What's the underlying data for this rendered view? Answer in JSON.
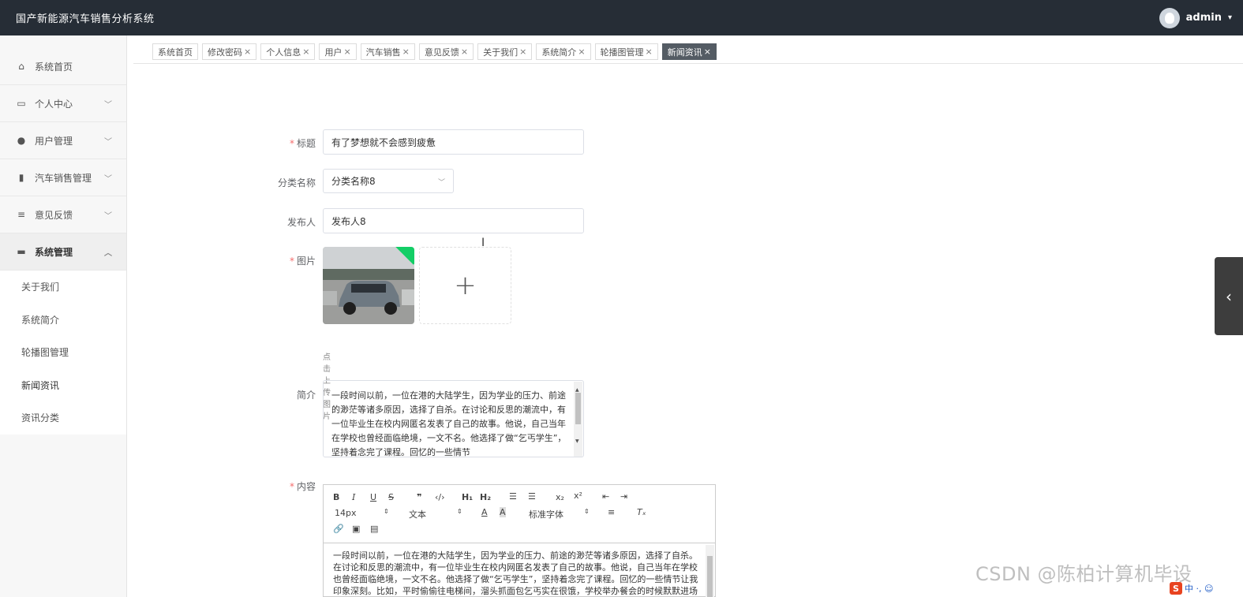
{
  "header": {
    "app_title": "国产新能源汽车销售分析系统",
    "username": "admin",
    "caret": "▾"
  },
  "sidebar": {
    "items": [
      {
        "label": "系统首页",
        "icon": "home-icon"
      },
      {
        "label": "个人中心",
        "icon": "id-card-icon"
      },
      {
        "label": "用户管理",
        "icon": "user-icon"
      },
      {
        "label": "汽车销售管理",
        "icon": "bookmark-icon"
      },
      {
        "label": "意见反馈",
        "icon": "list-icon"
      },
      {
        "label": "系统管理",
        "icon": "chat-icon"
      }
    ],
    "sub_items": [
      "关于我们",
      "系统简介",
      "轮播图管理",
      "新闻资讯",
      "资讯分类"
    ],
    "active_sub": "新闻资讯"
  },
  "tabs": [
    {
      "label": "系统首页",
      "closable": false
    },
    {
      "label": "修改密码",
      "closable": true
    },
    {
      "label": "个人信息",
      "closable": true
    },
    {
      "label": "用户",
      "closable": true
    },
    {
      "label": "汽车销售",
      "closable": true
    },
    {
      "label": "意见反馈",
      "closable": true
    },
    {
      "label": "关于我们",
      "closable": true
    },
    {
      "label": "系统简介",
      "closable": true
    },
    {
      "label": "轮播图管理",
      "closable": true
    },
    {
      "label": "新闻资讯",
      "closable": true,
      "active": true
    }
  ],
  "form": {
    "title_label": "标题",
    "title_value": "有了梦想就不会感到疲惫",
    "category_label": "分类名称",
    "category_value": "分类名称8",
    "publisher_label": "发布人",
    "publisher_value": "发布人8",
    "image_label": "图片",
    "upload_plus": "+",
    "upload_hint": "点击上传图片",
    "intro_label": "简介",
    "intro_text": "一段时间以前，一位在港的大陆学生，因为学业的压力、前途的渺茫等诸多原因，选择了自杀。在讨论和反思的潮流中，有一位毕业生在校内网匿名发表了自己的故事。他说，自己当年在学校也曾经面临绝境，一文不名。他选择了做“乞丐学生”，坚持着念完了课程。回忆的一些情节",
    "content_label": "内容",
    "required_mark": "*"
  },
  "editor": {
    "toolbar_row1": [
      "B",
      "I",
      "U",
      "S",
      "99",
      "</>",
      "H1",
      "H2",
      "ol",
      "ul",
      "x2",
      "x²",
      "outdent",
      "indent"
    ],
    "font_size": "14px",
    "text_type": "文本",
    "font_family": "标准字体",
    "content_text": "一段时间以前，一位在港的大陆学生，因为学业的压力、前途的渺茫等诸多原因，选择了自杀。在讨论和反思的潮流中，有一位毕业生在校内网匿名发表了自己的故事。他说，自己当年在学校也曾经面临绝境，一文不名。他选择了做“乞丐学生”，坚持着念完了课程。回忆的一些情节让我印象深刻。比如，平时偷偷往电梯间，溜头抓面包乞丐实在很饿，学校举办餐会的时候默默进场"
  },
  "overlay": {
    "watermark": "CSDN @陈柏计算机毕设",
    "ime_logo": "S",
    "ime_text": "中 ·, ☺"
  },
  "colors": {
    "topbar": "#262d36",
    "active_tab": "#545c64",
    "required": "#f56c6c",
    "upload_badge": "#13ce66"
  }
}
